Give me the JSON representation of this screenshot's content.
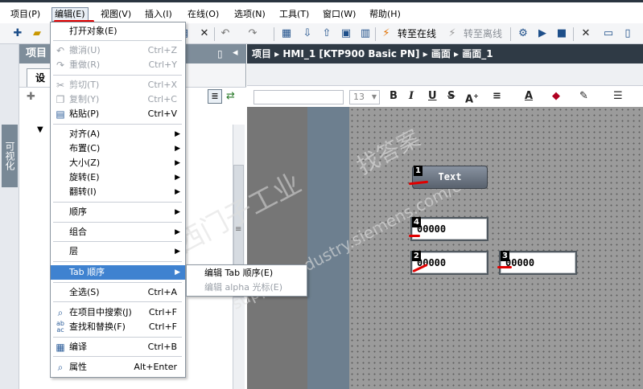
{
  "menubar": {
    "items": [
      "项目(P)",
      "编辑(E)",
      "视图(V)",
      "插入(I)",
      "在线(O)",
      "选项(N)",
      "工具(T)",
      "窗口(W)",
      "帮助(H)"
    ]
  },
  "toolbar": {
    "go_online": "转至在线",
    "go_offline": "转至离线"
  },
  "left_strip": {
    "tab_label": "可视化"
  },
  "tree": {
    "header_title": "项目",
    "tab_label": "设"
  },
  "editor": {
    "breadcrumb": "项目 ▸ HMI_1 [KTP900 Basic PN] ▸ 画面 ▸ 画面_1",
    "font_size": "13"
  },
  "edit_menu": {
    "items": [
      {
        "label": "打开对象(E)",
        "shortcut": "",
        "icon": "open-icon",
        "disabled": false,
        "submenu": false
      },
      {
        "label": "撤消(U)",
        "shortcut": "Ctrl+Z",
        "icon": "undo-icon",
        "disabled": true,
        "submenu": false
      },
      {
        "label": "重做(R)",
        "shortcut": "Ctrl+Y",
        "icon": "redo-icon",
        "disabled": true,
        "submenu": false
      },
      {
        "label": "剪切(T)",
        "shortcut": "Ctrl+X",
        "icon": "cut-icon",
        "disabled": true,
        "submenu": false
      },
      {
        "label": "复制(Y)",
        "shortcut": "Ctrl+C",
        "icon": "copy-icon",
        "disabled": true,
        "submenu": false
      },
      {
        "label": "粘贴(P)",
        "shortcut": "Ctrl+V",
        "icon": "paste-icon",
        "disabled": false,
        "submenu": false
      },
      {
        "label": "对齐(A)",
        "shortcut": "",
        "icon": "",
        "disabled": false,
        "submenu": true
      },
      {
        "label": "布置(C)",
        "shortcut": "",
        "icon": "",
        "disabled": false,
        "submenu": true
      },
      {
        "label": "大小(Z)",
        "shortcut": "",
        "icon": "",
        "disabled": false,
        "submenu": true
      },
      {
        "label": "旋转(E)",
        "shortcut": "",
        "icon": "",
        "disabled": false,
        "submenu": true
      },
      {
        "label": "翻转(I)",
        "shortcut": "",
        "icon": "",
        "disabled": false,
        "submenu": true
      },
      {
        "label": "顺序",
        "shortcut": "",
        "icon": "",
        "disabled": false,
        "submenu": true
      },
      {
        "label": "组合",
        "shortcut": "",
        "icon": "",
        "disabled": false,
        "submenu": true
      },
      {
        "label": "层",
        "shortcut": "",
        "icon": "",
        "disabled": false,
        "submenu": true
      },
      {
        "label": "Tab 顺序",
        "shortcut": "",
        "icon": "",
        "disabled": false,
        "submenu": true
      },
      {
        "label": "全选(S)",
        "shortcut": "Ctrl+A",
        "icon": "",
        "disabled": false,
        "submenu": false
      },
      {
        "label": "在项目中搜索(J)",
        "shortcut": "Ctrl+F",
        "icon": "search-icon",
        "disabled": false,
        "submenu": false
      },
      {
        "label": "查找和替换(F)",
        "shortcut": "Ctrl+F",
        "icon": "replace-icon",
        "disabled": false,
        "submenu": false
      },
      {
        "label": "编译",
        "shortcut": "Ctrl+B",
        "icon": "compile-icon",
        "disabled": false,
        "submenu": false
      },
      {
        "label": "属性",
        "shortcut": "Alt+Enter",
        "icon": "properties-icon",
        "disabled": false,
        "submenu": false
      }
    ]
  },
  "sub_menu": {
    "items": [
      {
        "label": "编辑 Tab 顺序(E)",
        "disabled": false
      },
      {
        "label": "编辑 alpha 光标(E)",
        "disabled": true
      }
    ]
  },
  "screen_objects": {
    "button_text": "Text",
    "io_value": "00000",
    "tab_badges": [
      "1",
      "4",
      "2",
      "3"
    ]
  },
  "watermark": {
    "line1": "西门子工业",
    "line2": "找答案",
    "line3": "support.industry.siemens.com/cs"
  },
  "colors": {
    "highlight": "#3f82d0",
    "annotation_red": "#e00000",
    "header_dark": "#2f3a45"
  }
}
